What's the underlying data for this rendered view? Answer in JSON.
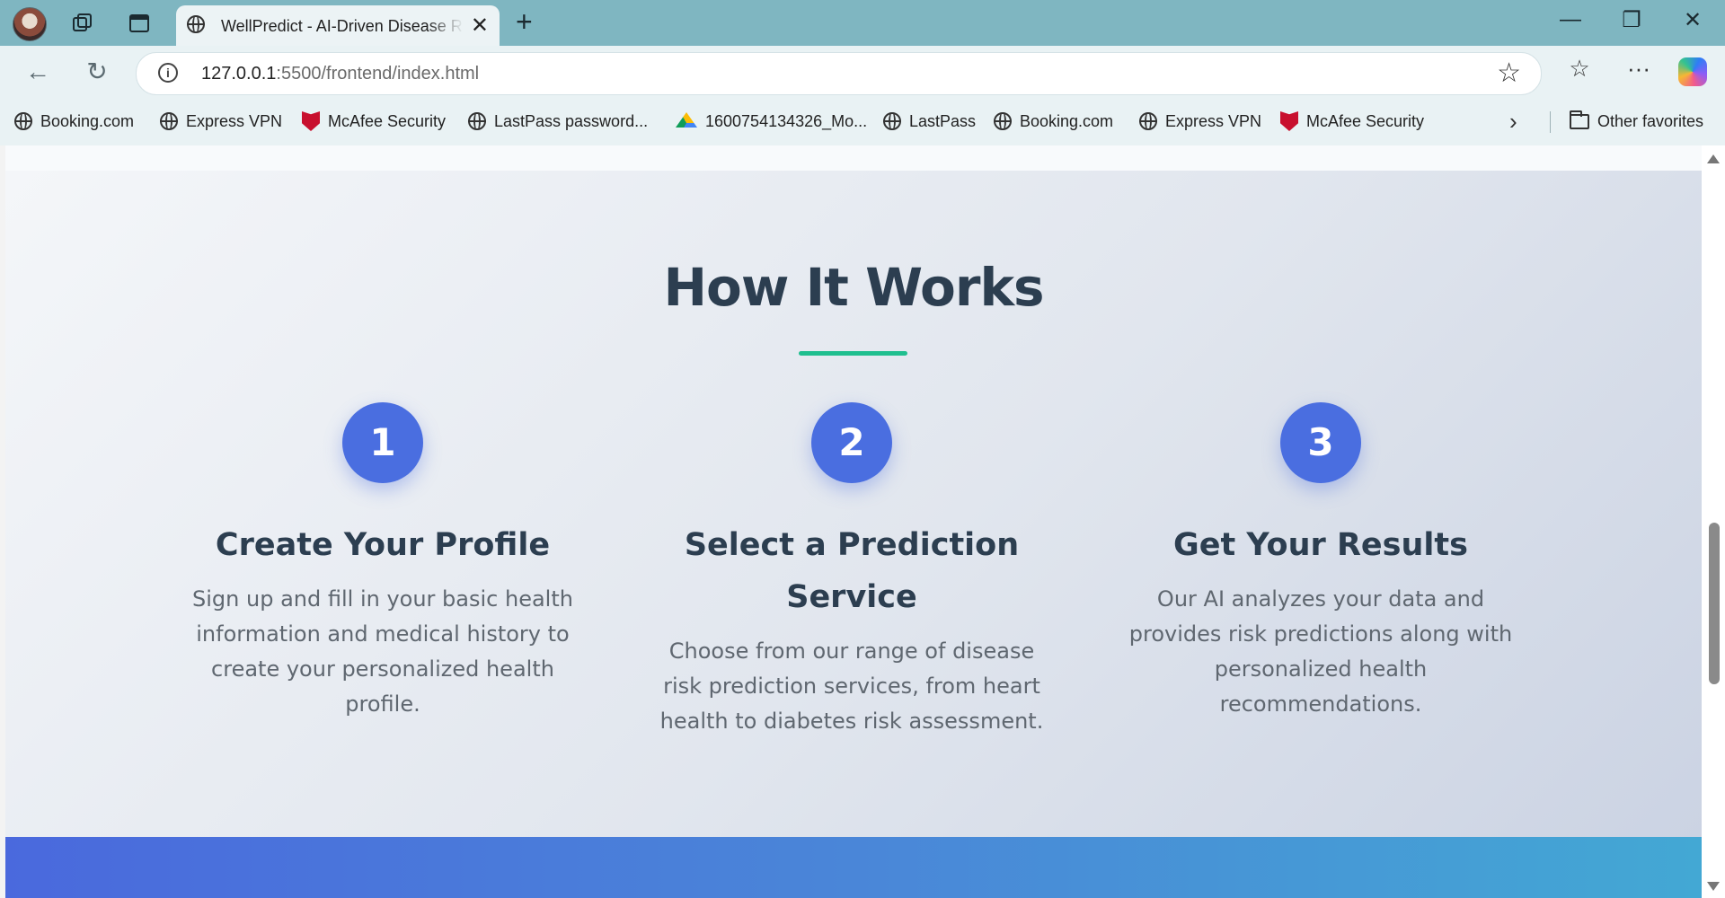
{
  "browser": {
    "tab_title": "WellPredict - AI-Driven Disease Risk Prediction",
    "url_host": "127.0.0.1",
    "url_path": ":5500/frontend/index.html",
    "window_controls": {
      "minimize": "—",
      "restore": "❐",
      "close": "✕"
    },
    "new_tab": "+"
  },
  "favorites": [
    {
      "label": "Booking.com",
      "icon": "globe-icon"
    },
    {
      "label": "Express VPN",
      "icon": "globe-icon"
    },
    {
      "label": "McAfee Security",
      "icon": "mcafee-shield-icon"
    },
    {
      "label": "LastPass password...",
      "icon": "globe-icon"
    },
    {
      "label": "1600754134326_Mo...",
      "icon": "google-drive-icon"
    },
    {
      "label": "LastPass",
      "icon": "globe-icon"
    },
    {
      "label": "Booking.com",
      "icon": "globe-icon"
    },
    {
      "label": "Express VPN",
      "icon": "globe-icon"
    },
    {
      "label": "McAfee Security",
      "icon": "mcafee-shield-icon"
    }
  ],
  "other_favorites": "Other favorites",
  "how_it_works": {
    "title": "How It Works",
    "accent_color": "#1fbf8f",
    "circle_color": "#4a6ee0",
    "steps": [
      {
        "number": "1",
        "title": "Create Your Profile",
        "text": "Sign up and fill in your basic health information and medical history to create your personalized health profile."
      },
      {
        "number": "2",
        "title": "Select a Prediction Service",
        "text": "Choose from our range of disease risk prediction services, from heart health to diabetes risk assessment."
      },
      {
        "number": "3",
        "title": "Get Your Results",
        "text": "Our AI analyzes your data and provides risk predictions along with personalized health recommendations."
      }
    ]
  }
}
